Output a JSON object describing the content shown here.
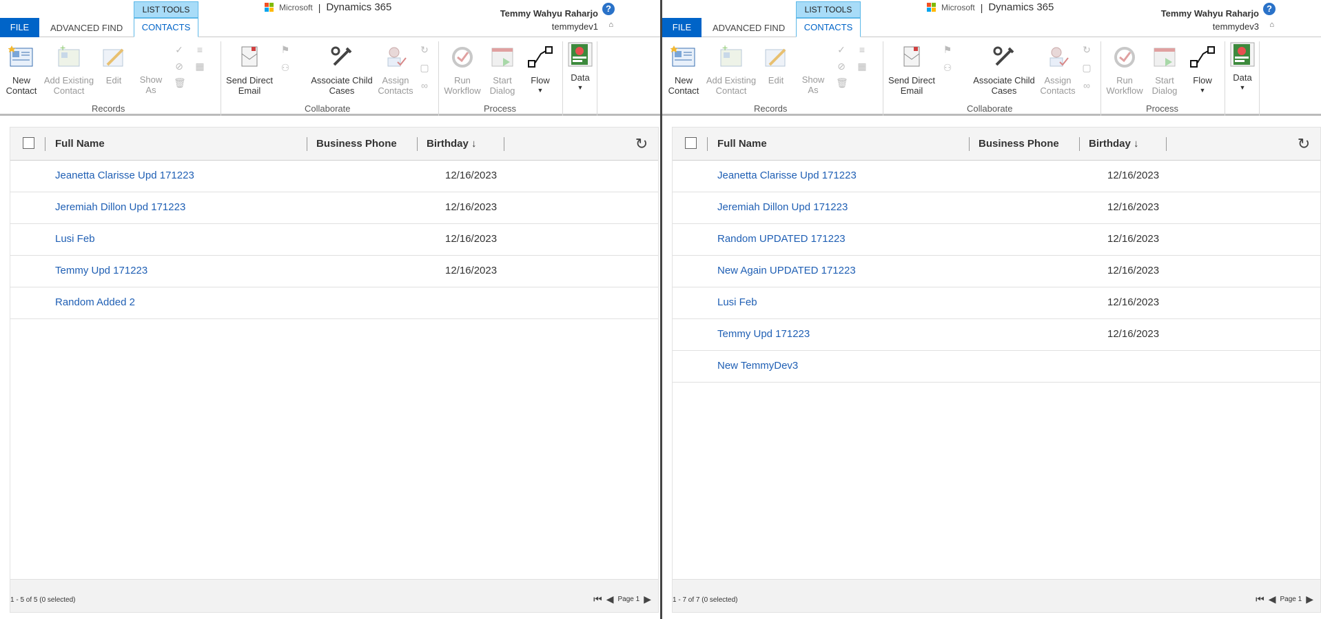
{
  "panes": [
    {
      "tabs": {
        "file": "FILE",
        "advanced_find": "ADVANCED FIND",
        "list_tools": "LIST TOOLS",
        "contacts": "CONTACTS"
      },
      "brand": {
        "microsoft": "Microsoft",
        "separator": "|",
        "product": "Dynamics 365"
      },
      "user": {
        "name": "Temmy Wahyu Raharjo",
        "org": "temmydev1"
      },
      "ribbon": {
        "new_contact": "New\nContact",
        "add_existing": "Add Existing\nContact",
        "edit": "Edit",
        "show_as": "Show\nAs",
        "send_email": "Send Direct\nEmail",
        "assoc_child": "Associate Child\nCases",
        "assign": "Assign\nContacts",
        "run_workflow": "Run\nWorkflow",
        "start_dialog": "Start\nDialog",
        "flow": "Flow",
        "data": "Data",
        "group_records": "Records",
        "group_collaborate": "Collaborate",
        "group_process": "Process"
      },
      "grid": {
        "columns": [
          "Full Name",
          "Business Phone",
          "Birthday"
        ],
        "rows": [
          {
            "name": "Jeanetta Clarisse Upd 171223",
            "birthday": "12/16/2023"
          },
          {
            "name": "Jeremiah Dillon Upd 171223",
            "birthday": "12/16/2023"
          },
          {
            "name": "Lusi Feb",
            "birthday": "12/16/2023"
          },
          {
            "name": "Temmy Upd 171223",
            "birthday": "12/16/2023"
          },
          {
            "name": "Random Added 2",
            "birthday": ""
          }
        ],
        "count": "1 - 5 of 5 (0 selected)",
        "page": "Page 1"
      }
    },
    {
      "tabs": {
        "file": "FILE",
        "advanced_find": "ADVANCED FIND",
        "list_tools": "LIST TOOLS",
        "contacts": "CONTACTS"
      },
      "brand": {
        "microsoft": "Microsoft",
        "separator": "|",
        "product": "Dynamics 365"
      },
      "user": {
        "name": "Temmy Wahyu Raharjo",
        "org": "temmydev3"
      },
      "ribbon": {
        "new_contact": "New\nContact",
        "add_existing": "Add Existing\nContact",
        "edit": "Edit",
        "show_as": "Show\nAs",
        "send_email": "Send Direct\nEmail",
        "assoc_child": "Associate Child\nCases",
        "assign": "Assign\nContacts",
        "run_workflow": "Run\nWorkflow",
        "start_dialog": "Start\nDialog",
        "flow": "Flow",
        "data": "Data",
        "group_records": "Records",
        "group_collaborate": "Collaborate",
        "group_process": "Process"
      },
      "grid": {
        "columns": [
          "Full Name",
          "Business Phone",
          "Birthday"
        ],
        "rows": [
          {
            "name": "Jeanetta Clarisse Upd 171223",
            "birthday": "12/16/2023"
          },
          {
            "name": "Jeremiah Dillon Upd 171223",
            "birthday": "12/16/2023"
          },
          {
            "name": "Random UPDATED 171223",
            "birthday": "12/16/2023"
          },
          {
            "name": "New Again UPDATED 171223",
            "birthday": "12/16/2023"
          },
          {
            "name": "Lusi Feb",
            "birthday": "12/16/2023"
          },
          {
            "name": "Temmy Upd 171223",
            "birthday": "12/16/2023"
          },
          {
            "name": "New TemmyDev3",
            "birthday": ""
          }
        ],
        "count": "1 - 7 of 7 (0 selected)",
        "page": "Page 1"
      }
    }
  ],
  "colors": {
    "accent": "#0064c8",
    "link": "#1f5fb4",
    "list_tools": "#a8dcf8"
  },
  "icons": [
    "help-icon",
    "refresh-icon",
    "checkbox-icon",
    "sort-down-icon",
    "first-page-icon",
    "prev-page-icon",
    "next-page-icon",
    "microsoft-logo-icon"
  ]
}
